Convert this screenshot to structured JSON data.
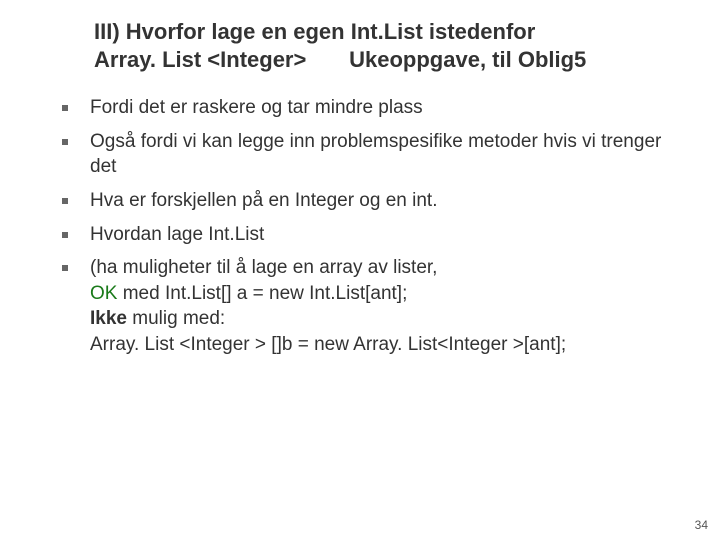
{
  "title": {
    "line1": "III) Hvorfor lage en egen Int.List istedenfor",
    "line2": "Array. List <Integer>       Ukeoppgave, til Oblig5"
  },
  "bullets": {
    "b1": "Fordi det er raskere og tar mindre plass",
    "b2": "Også fordi vi kan legge inn problemspesifike metoder hvis vi trenger det",
    "b3": "Hva er forskjellen på en Integer og en int.",
    "b4": "Hvordan lage Int.List",
    "b5_line1": "(ha muligheter til å lage en array av lister,",
    "b5_ok": " OK",
    "b5_line2_tail": " med Int.List[] a = new Int.List[ant];",
    "b5_ikke": " Ikke",
    "b5_line3_tail": " mulig med:",
    "b5_line4": " Array. List <Integer > []b = new Array. List<Integer >[ant];"
  },
  "page_number": "34"
}
